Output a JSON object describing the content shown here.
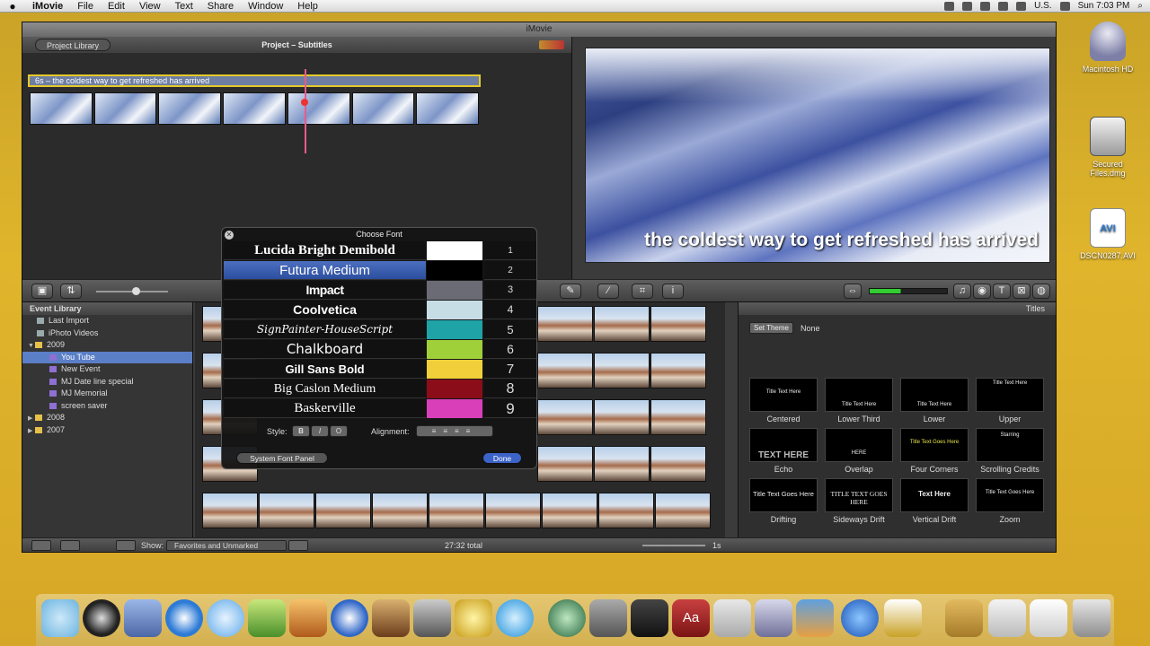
{
  "menubar": {
    "app_name": "iMovie",
    "items": [
      "File",
      "Edit",
      "View",
      "Text",
      "Share",
      "Window",
      "Help"
    ],
    "locale": "U.S.",
    "clock": "Sun 7:03 PM"
  },
  "window": {
    "title": "iMovie",
    "project_library_button": "Project Library",
    "project_title": "Project – Subtitles",
    "subtitle_bar": "6s – the coldest way to get refreshed has arrived",
    "viewer_caption": "the coldest way to get refreshed has arrived"
  },
  "font_panel": {
    "title": "Choose Font",
    "fonts": [
      {
        "name": "Lucida Bright Demibold",
        "color": "#ffffff",
        "num": "1"
      },
      {
        "name": "Futura Medium",
        "color": "#000000",
        "num": "2"
      },
      {
        "name": "Impact",
        "color": "#6a6b74",
        "num": "3"
      },
      {
        "name": "Coolvetica",
        "color": "#c7dde6",
        "num": "4"
      },
      {
        "name": "SignPainter-HouseScript",
        "color": "#1fa3a6",
        "num": "5"
      },
      {
        "name": "Chalkboard",
        "color": "#9fd03a",
        "num": "6"
      },
      {
        "name": "Gill Sans Bold",
        "color": "#f1cf3a",
        "num": "7"
      },
      {
        "name": "Big Caslon Medium",
        "color": "#8b0d1a",
        "num": "8"
      },
      {
        "name": "Baskerville",
        "color": "#d93fb8",
        "num": "9"
      }
    ],
    "style_label": "Style:",
    "style_buttons": [
      "B",
      "I",
      "O"
    ],
    "alignment_label": "Alignment:",
    "system_font_panel": "System Font Panel",
    "done": "Done"
  },
  "event_library": {
    "header": "Event Library",
    "items": [
      {
        "label": "Last Import"
      },
      {
        "label": "iPhoto Videos"
      },
      {
        "label": "2009"
      },
      {
        "label": "You Tube"
      },
      {
        "label": "New Event"
      },
      {
        "label": "MJ Date line special"
      },
      {
        "label": "MJ Memorial"
      },
      {
        "label": "screen saver"
      },
      {
        "label": "2008"
      },
      {
        "label": "2007"
      }
    ]
  },
  "titles": {
    "header": "Titles",
    "set_theme": "Set Theme",
    "theme_value": "None",
    "tiles": [
      {
        "label": "Centered",
        "text": "Title Text Here"
      },
      {
        "label": "Lower Third",
        "text": "Title Text Here"
      },
      {
        "label": "Lower",
        "text": "Title Text Here"
      },
      {
        "label": "Upper",
        "text": "Title Text Here"
      },
      {
        "label": "Echo",
        "text": "TEXT HERE"
      },
      {
        "label": "Overlap",
        "text": "HERE"
      },
      {
        "label": "Four Corners",
        "text": "Title Text Goes Here"
      },
      {
        "label": "Scrolling Credits",
        "text": "Starring"
      },
      {
        "label": "Drifting",
        "text": "Title Text Goes Here"
      },
      {
        "label": "Sideways Drift",
        "text": "TITLE TEXT GOES HERE"
      },
      {
        "label": "Vertical Drift",
        "text": "Text Here"
      },
      {
        "label": "Zoom",
        "text": "Title Text Goes Here"
      }
    ]
  },
  "bottombar": {
    "show_label": "Show:",
    "show_value": "Favorites and Unmarked",
    "total": "27:32 total",
    "zoom": "1s"
  },
  "desktop": {
    "icons": [
      "Macintosh HD",
      "Secured Files.dmg",
      "DSCN0287.AVI"
    ]
  }
}
